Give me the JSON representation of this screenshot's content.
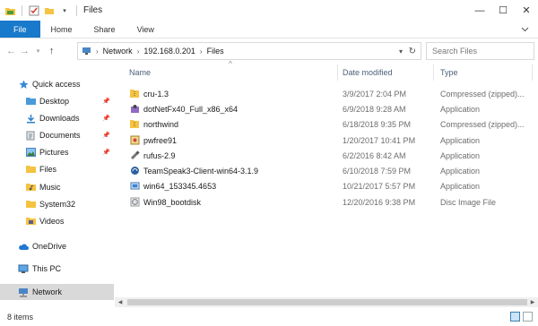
{
  "window": {
    "title": "Files",
    "controls": {
      "minimize": "—",
      "maximize": "☐",
      "close": "✕"
    }
  },
  "ribbon": {
    "tabs": [
      {
        "label": "File",
        "active": true
      },
      {
        "label": "Home"
      },
      {
        "label": "Share"
      },
      {
        "label": "View"
      }
    ]
  },
  "address": {
    "breadcrumbs": [
      "Network",
      "192.168.0.201",
      "Files"
    ]
  },
  "search": {
    "placeholder": "Search Files"
  },
  "sidebar": {
    "items": [
      {
        "label": "Quick access",
        "icon": "star-icon"
      },
      {
        "label": "Desktop",
        "icon": "folder-blue-icon",
        "pinned": true
      },
      {
        "label": "Downloads",
        "icon": "downloads-icon",
        "pinned": true
      },
      {
        "label": "Documents",
        "icon": "documents-icon",
        "pinned": true
      },
      {
        "label": "Pictures",
        "icon": "pictures-icon",
        "pinned": true
      },
      {
        "label": "Files",
        "icon": "folder-icon"
      },
      {
        "label": "Music",
        "icon": "music-icon"
      },
      {
        "label": "System32",
        "icon": "folder-icon"
      },
      {
        "label": "Videos",
        "icon": "videos-icon"
      },
      {
        "label": "OneDrive",
        "icon": "cloud-icon"
      },
      {
        "label": "This PC",
        "icon": "computer-icon"
      },
      {
        "label": "Network",
        "icon": "network-icon",
        "selected": true
      }
    ]
  },
  "columns": {
    "name": "Name",
    "date": "Date modified",
    "type": "Type"
  },
  "files": [
    {
      "name": "cru-1.3",
      "date": "3/9/2017 2:04 PM",
      "type": "Compressed (zipped)...",
      "icon": "zip-icon"
    },
    {
      "name": "dotNetFx40_Full_x86_x64",
      "date": "6/9/2018 9:28 AM",
      "type": "Application",
      "icon": "installer-icon"
    },
    {
      "name": "northwind",
      "date": "6/18/2018 9:35 PM",
      "type": "Compressed (zipped)...",
      "icon": "zip-icon"
    },
    {
      "name": "pwfree91",
      "date": "1/20/2017 10:41 PM",
      "type": "Application",
      "icon": "app-icon"
    },
    {
      "name": "rufus-2.9",
      "date": "6/2/2016 8:42 AM",
      "type": "Application",
      "icon": "usb-icon"
    },
    {
      "name": "TeamSpeak3-Client-win64-3.1.9",
      "date": "6/10/2018 7:59 PM",
      "type": "Application",
      "icon": "teamspeak-icon"
    },
    {
      "name": "win64_153345.4653",
      "date": "10/21/2017 5:57 PM",
      "type": "Application",
      "icon": "setup-icon"
    },
    {
      "name": "Win98_bootdisk",
      "date": "12/20/2016 9:38 PM",
      "type": "Disc Image File",
      "icon": "disc-icon"
    }
  ],
  "status": {
    "item_count": "8 items"
  },
  "colors": {
    "accent": "#1979ca",
    "folder": "#f5c342",
    "selected": "#d9d9d9"
  }
}
